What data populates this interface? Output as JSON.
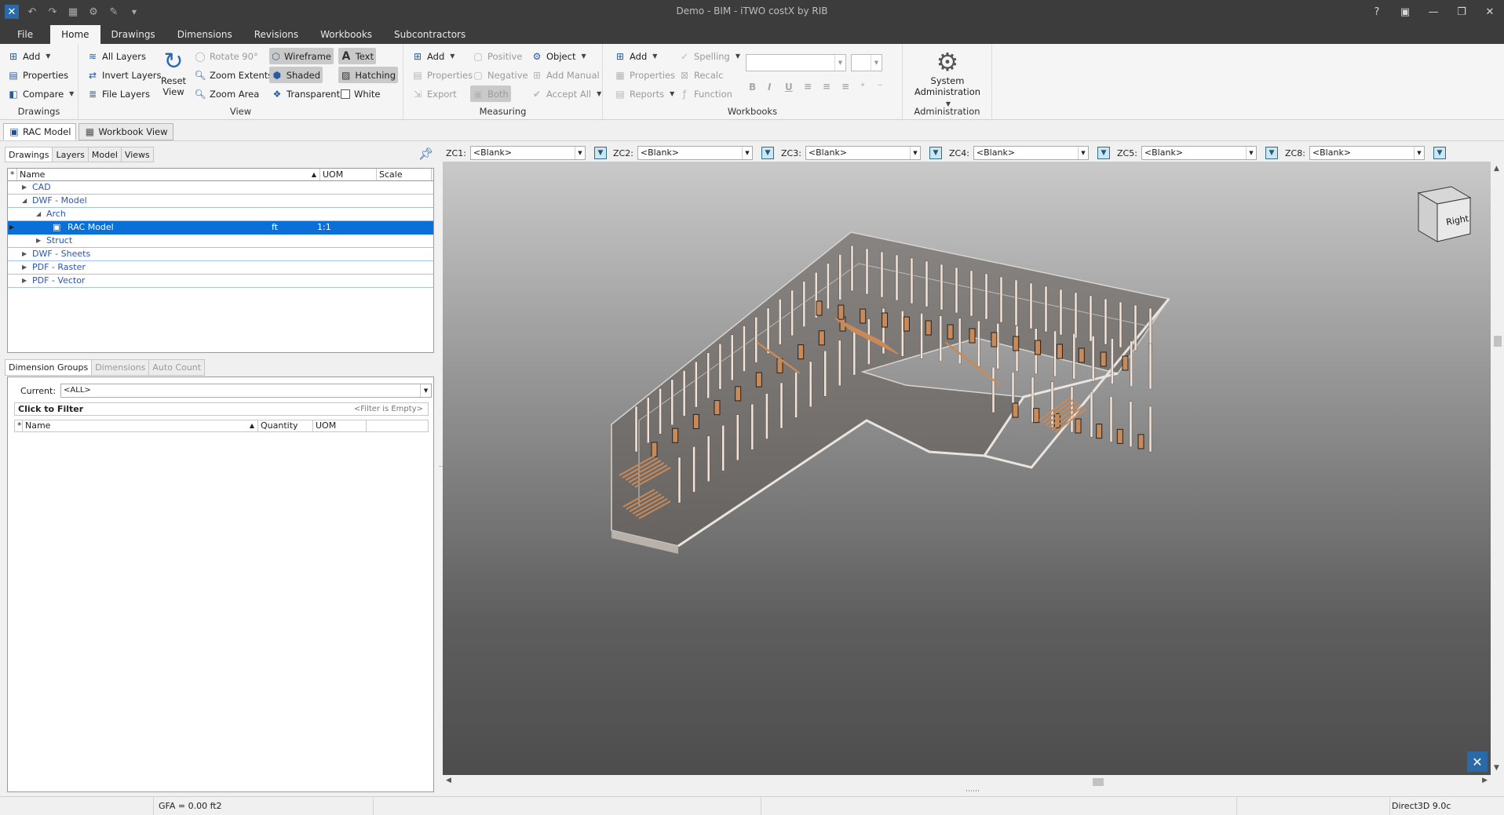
{
  "titlebar": {
    "title": "Demo - BIM - iTWO costX by RIB",
    "controls": [
      "?",
      "▣",
      "—",
      "❐",
      "✕"
    ]
  },
  "tabs": [
    "File",
    "Home",
    "Drawings",
    "Dimensions",
    "Revisions",
    "Workbooks",
    "Subcontractors"
  ],
  "ribbon": {
    "drawings": {
      "label": "Drawings",
      "add": "Add",
      "properties": "Properties",
      "compare": "Compare"
    },
    "layers": {
      "all": "All Layers",
      "invert": "Invert Layers",
      "file": "File Layers"
    },
    "view": {
      "label": "View",
      "reset": "Reset View",
      "rotate": "Rotate 90°",
      "zoom_extents": "Zoom Extents",
      "zoom_area": "Zoom Area",
      "wireframe": "Wireframe",
      "shaded": "Shaded",
      "transparent": "Transparent",
      "text": "Text",
      "hatching": "Hatching",
      "white": "White"
    },
    "measuring": {
      "label": "Measuring",
      "add": "Add",
      "properties": "Properties",
      "export": "Export",
      "positive": "Positive",
      "negative": "Negative",
      "both": "Both",
      "object": "Object",
      "add_manual": "Add Manual",
      "accept_all": "Accept All"
    },
    "workbooks": {
      "label": "Workbooks",
      "add": "Add",
      "properties": "Properties",
      "reports": "Reports",
      "spelling": "Spelling",
      "recalc": "Recalc",
      "function": "Function"
    },
    "administration": {
      "label": "Administration",
      "system": "System",
      "administration": "Administration"
    }
  },
  "doc_tabs": [
    "RAC Model",
    "Workbook View"
  ],
  "left_panel": {
    "tabs": [
      "Drawings",
      "Layers",
      "Model",
      "Views"
    ],
    "tree_headers": {
      "name": "Name",
      "uom": "UOM",
      "scale": "Scale"
    },
    "tree": [
      {
        "label": "CAD",
        "uom": "",
        "scale": ""
      },
      {
        "label": "DWF - Model",
        "uom": "",
        "scale": ""
      },
      {
        "label": "Arch",
        "uom": "",
        "scale": ""
      },
      {
        "label": "RAC Model",
        "uom": "ft",
        "scale": "1:1"
      },
      {
        "label": "Struct",
        "uom": "",
        "scale": ""
      },
      {
        "label": "DWF - Sheets",
        "uom": "",
        "scale": ""
      },
      {
        "label": "PDF - Raster",
        "uom": "",
        "scale": ""
      },
      {
        "label": "PDF - Vector",
        "uom": "",
        "scale": ""
      }
    ],
    "dim_tabs": [
      "Dimension Groups",
      "Dimensions",
      "Auto Count"
    ],
    "current_label": "Current:",
    "current_value": "<ALL>",
    "filter_label": "Click to Filter",
    "filter_hint": "<Filter is Empty>",
    "dim_headers": {
      "name": "Name",
      "quantity": "Quantity",
      "uom": "UOM"
    }
  },
  "zones": [
    {
      "label": "ZC1:",
      "value": "<Blank>"
    },
    {
      "label": "ZC2:",
      "value": "<Blank>"
    },
    {
      "label": "ZC3:",
      "value": "<Blank>"
    },
    {
      "label": "ZC4:",
      "value": "<Blank>"
    },
    {
      "label": "ZC5:",
      "value": "<Blank>"
    },
    {
      "label": "ZC8:",
      "value": "<Blank>"
    }
  ],
  "viewcube_face": "Right",
  "statusbar": {
    "gfa": "GFA = 0.00 ft2",
    "renderer": "Direct3D 9.0c"
  },
  "colors": {
    "titlebar": "#3c3c3c",
    "selection": "#0a6fd6",
    "accent": "#1d5cad",
    "model_wood": "#c98a5a"
  }
}
